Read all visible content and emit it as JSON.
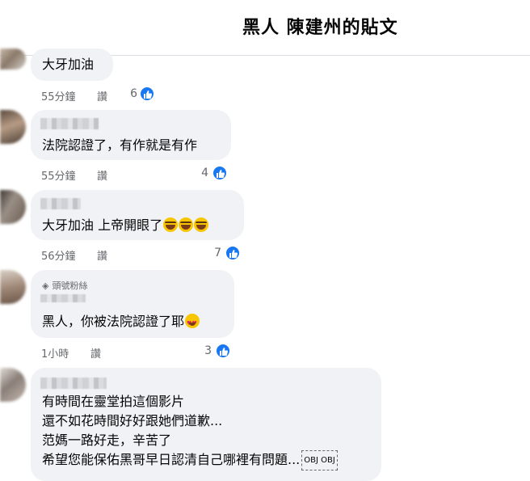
{
  "header": {
    "title": "黑人 陳建州的貼文"
  },
  "comments": [
    {
      "text": "大牙加油",
      "time": "55分鐘",
      "reply": "讚",
      "likes": "6"
    },
    {
      "text": "法院認證了，有作就是有作",
      "time": "55分鐘",
      "reply": "讚",
      "likes": "4"
    },
    {
      "text": "大牙加油 上帝開眼了",
      "time": "56分鐘",
      "reply": "讚",
      "likes": "7",
      "emoji": "laughing-emoji"
    },
    {
      "badge": "頭號粉絲",
      "text": "黑人，你被法院認證了耶",
      "time": "1小時",
      "reply": "讚",
      "likes": "3",
      "emoji": "heart-eyes-emoji"
    },
    {
      "lines": [
        "有時間在靈堂拍這個影片",
        "還不如花時間好好跟她們道歉...",
        "范媽一路好走，辛苦了",
        "希望您能保佑黑哥早日認清自己哪裡有問題..."
      ],
      "sticker": "OBJ OBJ"
    }
  ],
  "icons": {
    "like": "thumbs-up-icon",
    "badge": "diamond-icon"
  },
  "colors": {
    "like_blue": "#1877f2",
    "bubble": "#f0f2f5",
    "meta": "#65676b"
  }
}
